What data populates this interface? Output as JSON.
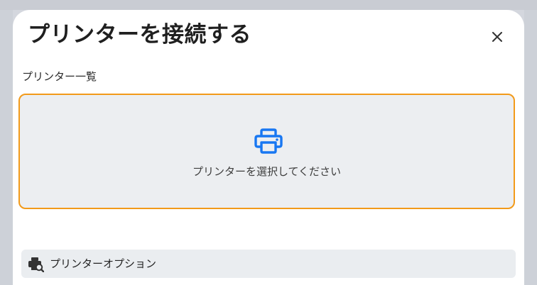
{
  "dialog": {
    "title": "プリンターを接続する",
    "close_icon": "close-icon"
  },
  "printer_list": {
    "label": "プリンター一覧",
    "placeholder": "プリンターを選択してください",
    "icon": "printer-icon",
    "border_color": "#f29a1a",
    "icon_color": "#1877f2"
  },
  "printer_options": {
    "label": "プリンターオプション",
    "icon": "printer-search-icon"
  }
}
